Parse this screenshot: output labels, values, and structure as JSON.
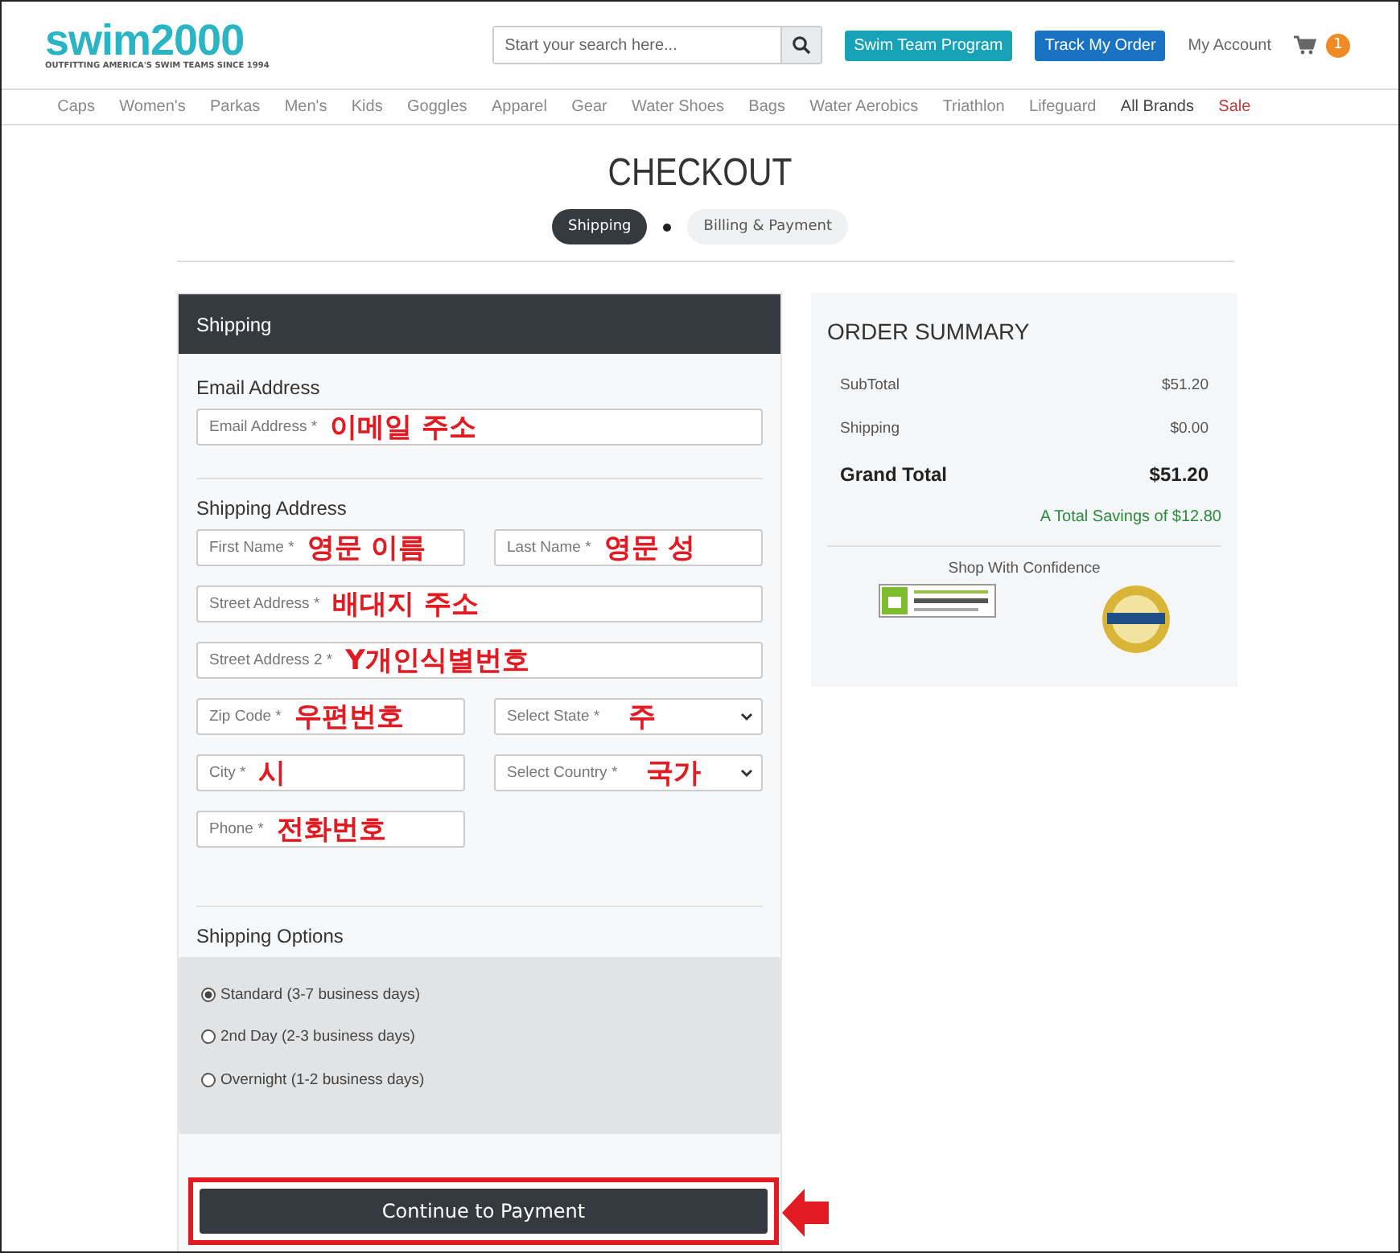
{
  "header": {
    "logo": "swim2000",
    "tagline": "OUTFITTING AMERICA'S SWIM TEAMS SINCE 1994",
    "search": {
      "placeholder": "Start your search here..."
    },
    "buttons": [
      {
        "label": "Swim Team Program",
        "kind": "teal"
      },
      {
        "label": "Track My Order",
        "kind": "blue"
      }
    ],
    "account": "My Account",
    "cart_count": "1"
  },
  "nav": [
    {
      "label": "Caps",
      "kind": "link"
    },
    {
      "label": "Women's",
      "kind": "link"
    },
    {
      "label": "Parkas",
      "kind": "link"
    },
    {
      "label": "Men's",
      "kind": "link"
    },
    {
      "label": "Kids",
      "kind": "link"
    },
    {
      "label": "Goggles",
      "kind": "link"
    },
    {
      "label": "Apparel",
      "kind": "link"
    },
    {
      "label": "Gear",
      "kind": "link"
    },
    {
      "label": "Water Shoes",
      "kind": "link"
    },
    {
      "label": "Bags",
      "kind": "link"
    },
    {
      "label": "Water Aerobics",
      "kind": "link"
    },
    {
      "label": "Triathlon",
      "kind": "link"
    },
    {
      "label": "Lifeguard",
      "kind": "link"
    },
    {
      "label": "All Brands",
      "kind": "strong"
    },
    {
      "label": "Sale",
      "kind": "sale"
    }
  ],
  "title": "CHECKOUT",
  "steps": [
    {
      "label": "Shipping",
      "selected": true
    },
    {
      "label": "Billing & Payment",
      "selected": false
    }
  ],
  "shipping": {
    "heading": "Shipping",
    "sections": [
      {
        "heading": "Email Address",
        "rows": [
          [
            {
              "placeholder": "Email Address *",
              "note": "이메일 주소",
              "kind": "text"
            }
          ]
        ]
      },
      {
        "heading": "Shipping Address",
        "rows": [
          [
            {
              "placeholder": "First Name *",
              "note": "영문 이름",
              "kind": "text"
            },
            {
              "placeholder": "Last Name *",
              "note": "영문 성",
              "kind": "text"
            }
          ],
          [
            {
              "placeholder": "Street Address *",
              "note": "배대지 주소",
              "kind": "text"
            }
          ],
          [
            {
              "placeholder": "Street Address 2 *",
              "note": "Y개인식별번호",
              "kind": "text"
            }
          ],
          [
            {
              "placeholder": "Zip Code *",
              "note": "우편번호",
              "kind": "text"
            },
            {
              "placeholder": "Select State *",
              "note": "주",
              "kind": "select"
            }
          ],
          [
            {
              "placeholder": "City *",
              "note": "시",
              "kind": "text"
            },
            {
              "placeholder": "Select Country *",
              "note": "국가",
              "kind": "select"
            }
          ],
          [
            {
              "placeholder": "Phone *",
              "note": "전화번호",
              "kind": "text"
            },
            null
          ]
        ]
      }
    ],
    "options_heading": "Shipping Options",
    "options": [
      {
        "label": "Standard (3-7 business days)",
        "selected": true
      },
      {
        "label": "2nd Day (2-3 business days)",
        "selected": false
      },
      {
        "label": "Overnight (1-2 business days)",
        "selected": false
      }
    ],
    "continue_button": "Continue to Payment"
  },
  "summary": {
    "heading": "ORDER SUMMARY",
    "lines": [
      {
        "label": "SubTotal",
        "value": "$51.20",
        "kind": "normal"
      },
      {
        "label": "Shipping",
        "value": "$0.00",
        "kind": "normal"
      },
      {
        "label": "Grand Total",
        "value": "$51.20",
        "kind": "total"
      }
    ],
    "savings": "A Total Savings of $12.80",
    "confidence": "Shop With Confidence"
  }
}
